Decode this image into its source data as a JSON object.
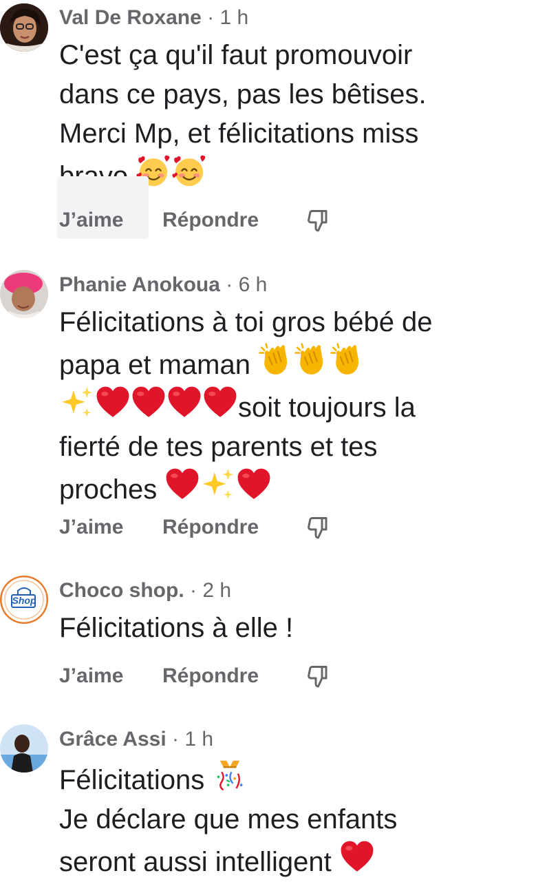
{
  "actions": {
    "like_label": "J’aime",
    "reply_label": "Répondre",
    "dislike_icon": "thumbs-down-icon"
  },
  "comments": [
    {
      "author": "Val De Roxane",
      "separator": "·",
      "time": "1 h",
      "lines": [
        "C'est ça qu'il faut promouvoir",
        "dans ce pays, pas les bêtises.",
        "Merci Mp, et félicitations miss",
        "bravo"
      ],
      "emoji": [
        "smiling-face-with-hearts-emoji",
        "smiling-face-with-hearts-emoji"
      ]
    },
    {
      "author": "Phanie Anokoua",
      "separator": "·",
      "time": "6 h",
      "lines": [
        "Félicitations à toi gros bébé de",
        "papa et maman",
        "soit toujours la",
        "fierté de tes parents et tes",
        "proches"
      ],
      "emoji": [
        "clapping-hands-emoji",
        "sparkles-emoji",
        "red-heart-emoji"
      ]
    },
    {
      "author": "Choco shop.",
      "separator": "·",
      "time": "2 h",
      "avatar_text": "Shop",
      "lines": [
        "Félicitations à elle !"
      ]
    },
    {
      "author": "Grâce Assi",
      "separator": "·",
      "time": "1 h",
      "lines": [
        "Félicitations",
        "Je déclare que mes enfants",
        "seront aussi intelligent"
      ],
      "emoji": [
        "party-popper-emoji",
        "red-heart-emoji"
      ]
    }
  ]
}
